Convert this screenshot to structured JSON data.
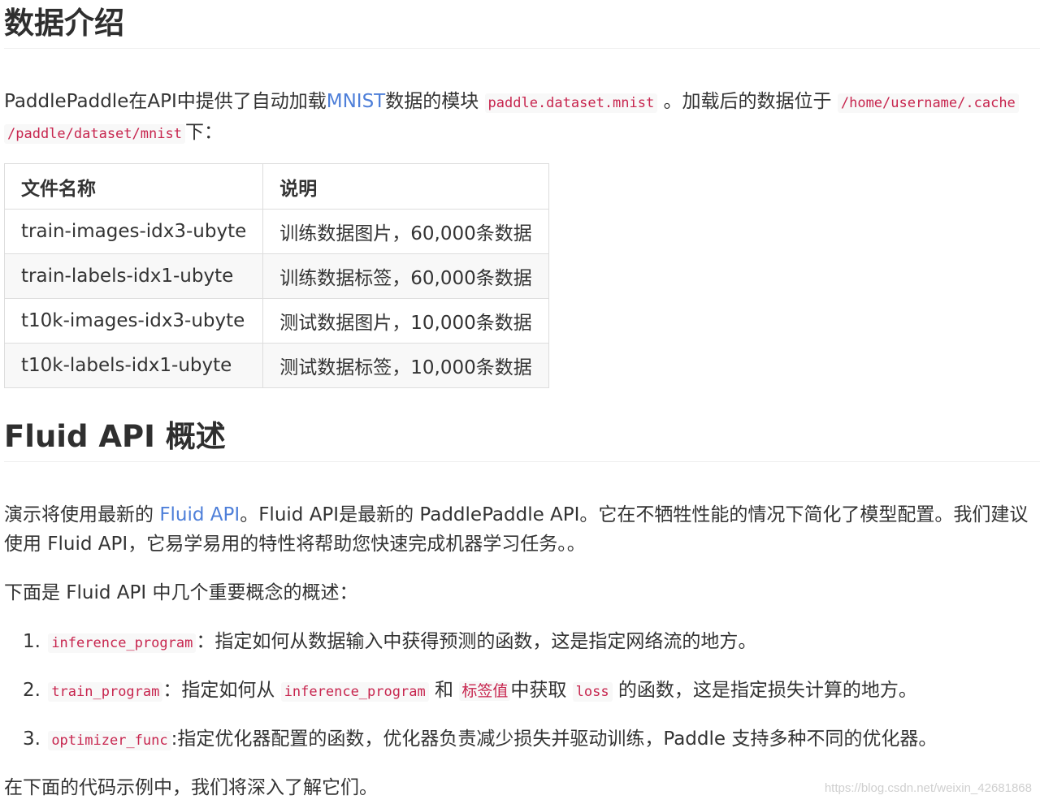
{
  "section1": {
    "title": "数据介绍",
    "intro": {
      "t1": "PaddlePaddle在API中提供了自动加载",
      "link": "MNIST",
      "t2": "数据的模块",
      "code1": "paddle.dataset.mnist",
      "t3": "。加载后的数据位于",
      "code2a": "/home/username/.cache",
      "code2b": "/paddle/dataset/mnist",
      "t4": "下："
    },
    "table": {
      "headers": [
        "文件名称",
        "说明"
      ],
      "rows": [
        [
          "train-images-idx3-ubyte",
          "训练数据图片，60,000条数据"
        ],
        [
          "train-labels-idx1-ubyte",
          "训练数据标签，60,000条数据"
        ],
        [
          "t10k-images-idx3-ubyte",
          "测试数据图片，10,000条数据"
        ],
        [
          "t10k-labels-idx1-ubyte",
          "测试数据标签，10,000条数据"
        ]
      ]
    }
  },
  "section2": {
    "title": "Fluid API 概述",
    "p1": {
      "t1": "演示将使用最新的 ",
      "link": "Fluid API",
      "t2": "。Fluid API是最新的 PaddlePaddle API。它在不牺牲性能的情况下简化了模型配置。我们建议",
      "line2": "使用 Fluid API，它易学易用的特性将帮助您快速完成机器学习任务。。"
    },
    "p2": "下面是 Fluid API 中几个重要概念的概述：",
    "items": [
      {
        "num": "1.",
        "code": "inference_program",
        "text": "：指定如何从数据输入中获得预测的函数，这是指定网络流的地方。"
      },
      {
        "num": "2.",
        "code": "train_program",
        "t1": "：指定如何从",
        "code2": "inference_program",
        "t2": "和",
        "tag": "标签值",
        "t3": "中获取",
        "code3": "loss",
        "t4": "的函数，这是指定损失计算的地方。"
      },
      {
        "num": "3.",
        "code": "optimizer_func",
        "text": ":指定优化器配置的函数，优化器负责减少损失并驱动训练，Paddle 支持多种不同的优化器。"
      }
    ],
    "p3": "在下面的代码示例中，我们将深入了解它们。"
  },
  "watermark": "https://blog.csdn.net/weixin_42681868"
}
